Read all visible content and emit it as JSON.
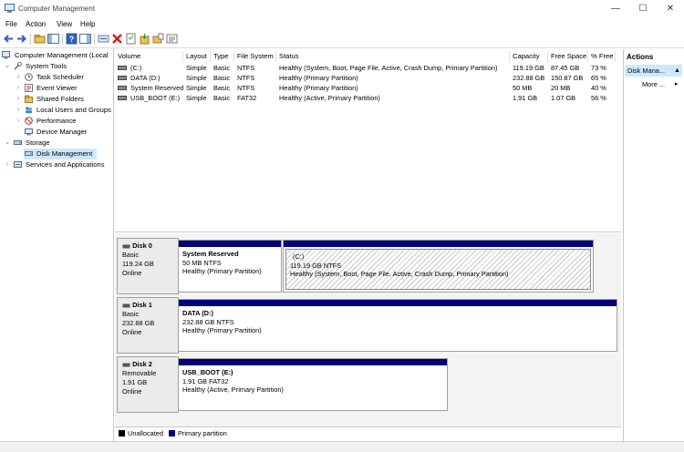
{
  "window": {
    "title": "Computer Management",
    "minimize": "—",
    "maximize": "☐",
    "close": "✕"
  },
  "menu": [
    "File",
    "Action",
    "View",
    "Help"
  ],
  "tree": {
    "root": "Computer Management (Local",
    "system_tools": "System Tools",
    "task_scheduler": "Task Scheduler",
    "event_viewer": "Event Viewer",
    "shared_folders": "Shared Folders",
    "local_users": "Local Users and Groups",
    "performance": "Performance",
    "device_manager": "Device Manager",
    "storage": "Storage",
    "disk_management": "Disk Management",
    "services": "Services and Applications"
  },
  "volumes": {
    "headers": [
      "Volume",
      "Layout",
      "Type",
      "File System",
      "Status",
      "Capacity",
      "Free Space",
      "% Free"
    ],
    "rows": [
      [
        "(C:)",
        "Simple",
        "Basic",
        "NTFS",
        "Healthy (System, Boot, Page File, Active, Crash Dump, Primary Partition)",
        "119.19 GB",
        "87.45 GB",
        "73 %"
      ],
      [
        "DATA (D:)",
        "Simple",
        "Basic",
        "NTFS",
        "Healthy (Primary Partition)",
        "232.88 GB",
        "150.87 GB",
        "65 %"
      ],
      [
        "System Reserved",
        "Simple",
        "Basic",
        "NTFS",
        "Healthy (Primary Partition)",
        "50 MB",
        "20 MB",
        "40 %"
      ],
      [
        "USB_BOOT (E:)",
        "Simple",
        "Basic",
        "FAT32",
        "Healthy (Active, Primary Partition)",
        "1.91 GB",
        "1.07 GB",
        "56 %"
      ]
    ]
  },
  "disks": [
    {
      "name": "Disk 0",
      "type": "Basic",
      "size": "119.24 GB",
      "state": "Online",
      "partitions": [
        {
          "name": "System Reserved",
          "fs": "50 MB NTFS",
          "status": "Healthy (Primary Partition)"
        },
        {
          "name": "(C:)",
          "fs": "119.19 GB NTFS",
          "status": "Healthy (System, Boot, Page File, Active, Crash Dump, Primary Partition)"
        }
      ]
    },
    {
      "name": "Disk 1",
      "type": "Basic",
      "size": "232.88 GB",
      "state": "Online",
      "partitions": [
        {
          "name": "DATA  (D:)",
          "fs": "232.88 GB NTFS",
          "status": "Healthy (Primary Partition)"
        }
      ]
    },
    {
      "name": "Disk 2",
      "type": "Removable",
      "size": "1.91 GB",
      "state": "Online",
      "partitions": [
        {
          "name": "USB_BOOT  (E:)",
          "fs": "1.91 GB FAT32",
          "status": "Healthy (Active, Primary Partition)"
        }
      ]
    }
  ],
  "legend": {
    "unallocated": "Unallocated",
    "primary": "Primary partition"
  },
  "actions": {
    "header": "Actions",
    "section": "Disk Mana...",
    "more": "More ..."
  },
  "colors": {
    "primary_partition": "#00007a",
    "unallocated": "#000000",
    "selection": "#cce8ff"
  }
}
